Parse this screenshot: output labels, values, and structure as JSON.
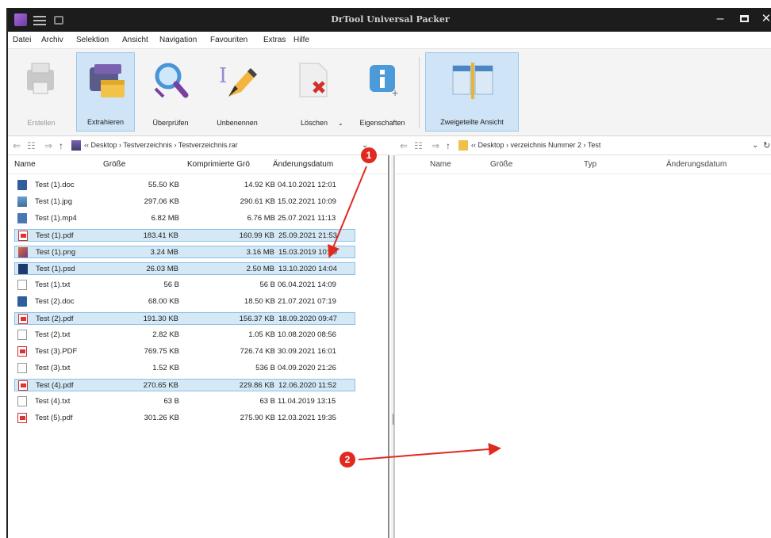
{
  "window": {
    "title": "DrTool Universal Packer"
  },
  "menu": [
    "Datei",
    "Archiv",
    "Selektion",
    "Ansicht",
    "Navigation",
    "Favouriten",
    "Extras",
    "Hilfe"
  ],
  "ribbon": {
    "create": "Erstellen",
    "extract": "Extrahieren",
    "verify": "Überprüfen",
    "rename": "Unbenennen",
    "delete": "Löschen",
    "properties": "Eigenschaften",
    "split_view": "Zweigeteilte Ansicht"
  },
  "left_pane": {
    "path": "‹‹ Desktop  ›  Testverzeichnis  ›  Testverzeichnis.rar",
    "columns": {
      "name": "Name",
      "size": "Größe",
      "compressed": "Komprimierte Grö",
      "modified": "Änderungsdatum"
    },
    "rows": [
      {
        "name": "Test (1).doc",
        "size": "55.50 KB",
        "compressed": "14.92 KB",
        "modified": "04.10.2021 12:01"
      },
      {
        "name": "Test (1).jpg",
        "size": "297.06 KB",
        "compressed": "290.61 KB",
        "modified": "15.02.2021 10:09"
      },
      {
        "name": "Test (1).mp4",
        "size": "6.82 MB",
        "compressed": "6.76 MB",
        "modified": "25.07.2021 11:13"
      },
      {
        "name": "Test (1).pdf",
        "size": "183.41 KB",
        "compressed": "160.99 KB",
        "modified": "25.09.2021 21:53"
      },
      {
        "name": "Test (1).png",
        "size": "3.24 MB",
        "compressed": "3.16 MB",
        "modified": "15.03.2019 10:20"
      },
      {
        "name": "Test (1).psd",
        "size": "26.03 MB",
        "compressed": "2.50 MB",
        "modified": "13.10.2020 14:04"
      },
      {
        "name": "Test (1).txt",
        "size": "56 B",
        "compressed": "56 B",
        "modified": "06.04.2021 14:09"
      },
      {
        "name": "Test (2).doc",
        "size": "68.00 KB",
        "compressed": "18.50 KB",
        "modified": "21.07.2021 07:19"
      },
      {
        "name": "Test (2).pdf",
        "size": "191.30 KB",
        "compressed": "156.37 KB",
        "modified": "18.09.2020 09:47"
      },
      {
        "name": "Test (2).txt",
        "size": "2.82 KB",
        "compressed": "1.05 KB",
        "modified": "10.08.2020 08:56"
      },
      {
        "name": "Test (3).PDF",
        "size": "769.75 KB",
        "compressed": "726.74 KB",
        "modified": "30.09.2021 16:01"
      },
      {
        "name": "Test (3).txt",
        "size": "1.52 KB",
        "compressed": "536 B",
        "modified": "04.09.2020 21:26"
      },
      {
        "name": "Test (4).pdf",
        "size": "270.65 KB",
        "compressed": "229.86 KB",
        "modified": "12.06.2020 11:52"
      },
      {
        "name": "Test (4).txt",
        "size": "63 B",
        "compressed": "63 B",
        "modified": "11.04.2019 13:15"
      },
      {
        "name": "Test (5).pdf",
        "size": "301.26 KB",
        "compressed": "275.90 KB",
        "modified": "12.03.2021 19:35"
      }
    ]
  },
  "right_pane": {
    "path": "‹‹ Desktop  ›  verzeichnis Nummer 2  ›  Test",
    "columns": {
      "name": "Name",
      "size": "Größe",
      "type": "Typ",
      "modified": "Änderungsdatum"
    }
  },
  "annotations": {
    "badge1": "1",
    "badge2": "2"
  },
  "colors": {
    "selection": "#d4e8f6",
    "annotation": "#e02a1f",
    "titlebar": "#1c1c1c"
  }
}
